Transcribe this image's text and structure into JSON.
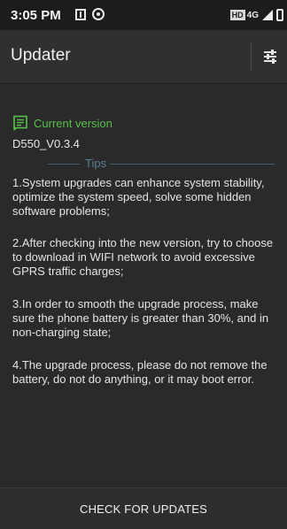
{
  "status_bar": {
    "time": "3:05 PM",
    "network_badge": "HD",
    "network_label": "4G"
  },
  "app_bar": {
    "title": "Updater",
    "settings_icon": "sliders-icon"
  },
  "current_version": {
    "icon": "document-icon",
    "label": "Current version",
    "value": "D550_V0.3.4"
  },
  "tips": {
    "label": "Tips",
    "items": [
      "1.System upgrades can enhance system stability, optimize the system speed, solve some hidden software problems;",
      "2.After checking into the new version, try to choose to download in WIFI network to avoid excessive GPRS traffic charges;",
      "3.In order to smooth the upgrade process, make sure the phone battery is greater than 30%, and in non-charging state;",
      "4.The upgrade process, please do not remove the battery, do not do anything, or it may boot error."
    ]
  },
  "actions": {
    "check_label": "CHECK FOR UPDATES"
  },
  "colors": {
    "accent_green": "#59c04d",
    "tips_blue": "#5b7f95",
    "background": "#2a2a2a"
  }
}
